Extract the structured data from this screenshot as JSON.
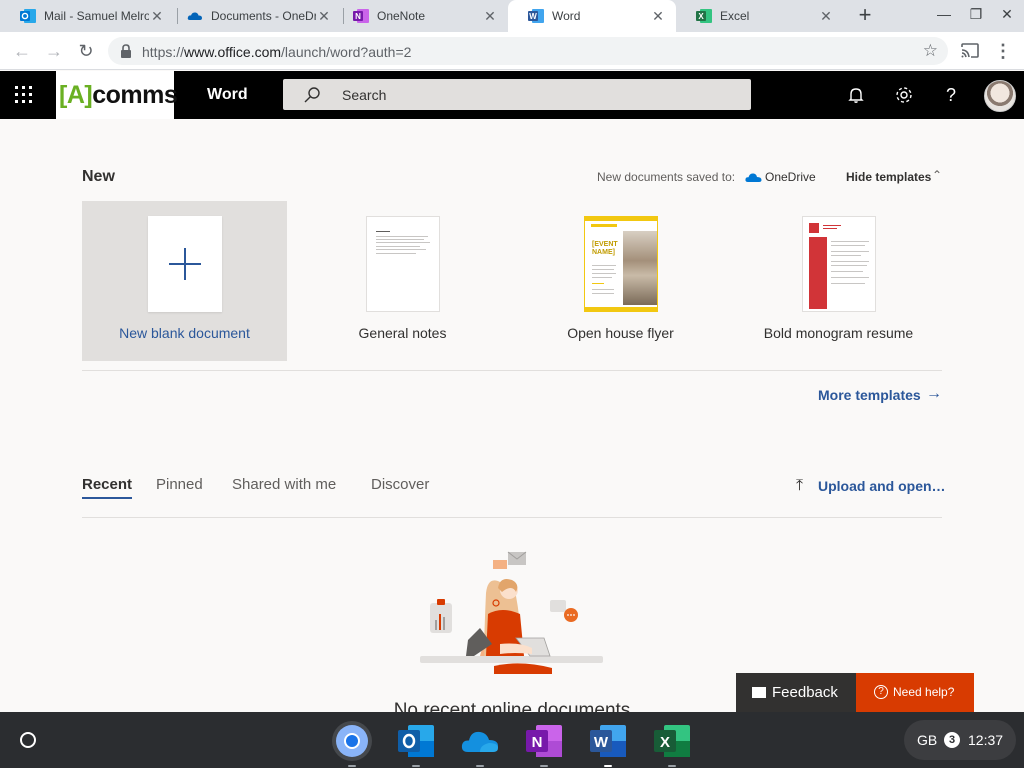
{
  "browser": {
    "tabs": [
      {
        "title": "Mail - Samuel Melro",
        "icon": "outlook-icon",
        "color": "#0078d4"
      },
      {
        "title": "Documents - OneDri",
        "icon": "onedrive-icon",
        "color": "#0364b8"
      },
      {
        "title": "OneNote",
        "icon": "onenote-icon",
        "color": "#7719aa"
      },
      {
        "title": "Word",
        "icon": "word-icon",
        "color": "#2b579a"
      },
      {
        "title": "Excel",
        "icon": "excel-icon",
        "color": "#217346"
      }
    ],
    "active_tab": 3,
    "url_prefix": "https://",
    "url_host": "www.office.com",
    "url_path": "/launch/word?auth=2"
  },
  "header": {
    "brand_left": "[A]",
    "brand_right": "comms",
    "app_name": "Word",
    "search_placeholder": "Search"
  },
  "new_section": {
    "heading": "New",
    "saved_to_label": "New documents saved to:",
    "saved_to_location": "OneDrive",
    "hide_templates": "Hide templates",
    "templates": [
      {
        "label": "New blank document"
      },
      {
        "label": "General notes"
      },
      {
        "label": "Open house flyer",
        "thumb_text": "[EVENT NAME]"
      },
      {
        "label": "Bold monogram resume"
      }
    ],
    "more_templates": "More templates"
  },
  "files_section": {
    "tabs": [
      "Recent",
      "Pinned",
      "Shared with me",
      "Discover"
    ],
    "active_tab": 0,
    "upload": "Upload and open…",
    "empty_message": "No recent online documents"
  },
  "feedback": {
    "feedback_label": "Feedback",
    "help_label": "Need help?"
  },
  "shelf": {
    "apps": [
      "chrome-icon",
      "outlook-icon",
      "onedrive-icon",
      "onenote-icon",
      "word-icon",
      "excel-icon"
    ],
    "keyboard": "GB",
    "notifications": "3",
    "time": "12:37"
  },
  "colors": {
    "word_blue": "#2b579a",
    "help_orange": "#d83b01",
    "header_black": "#000000"
  }
}
